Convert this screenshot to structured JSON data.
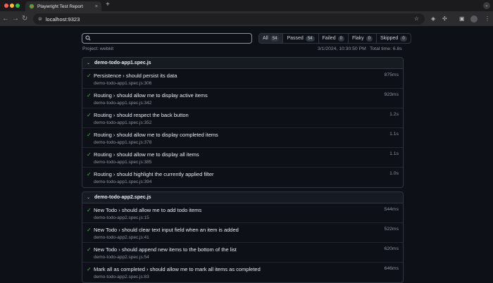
{
  "browser": {
    "tab_title": "Playwright Test Report",
    "tab_close": "×",
    "new_tab": "+",
    "url": "localhost:9323",
    "menu_glyph": "⌄"
  },
  "report": {
    "search": {
      "value": "",
      "placeholder": ""
    },
    "filters": [
      {
        "label": "All",
        "count": "54"
      },
      {
        "label": "Passed",
        "count": "54"
      },
      {
        "label": "Failed",
        "count": "0"
      },
      {
        "label": "Flaky",
        "count": "0"
      },
      {
        "label": "Skipped",
        "count": "0"
      }
    ],
    "project": "Project: webkit",
    "datetime": "3/1/2024, 10:30:50 PM",
    "total_time": "Total time: 6.8s",
    "groups": [
      {
        "file": "demo-todo-app1.spec.js",
        "tests": [
          {
            "title": "Persistence › should persist its data",
            "location": "demo-todo-app1.spec.js:306",
            "duration": "875ms"
          },
          {
            "title": "Routing › should allow me to display active items",
            "location": "demo-todo-app1.spec.js:342",
            "duration": "923ms"
          },
          {
            "title": "Routing › should respect the back button",
            "location": "demo-todo-app1.spec.js:352",
            "duration": "1.2s"
          },
          {
            "title": "Routing › should allow me to display completed items",
            "location": "demo-todo-app1.spec.js:378",
            "duration": "1.1s"
          },
          {
            "title": "Routing › should allow me to display all items",
            "location": "demo-todo-app1.spec.js:385",
            "duration": "1.1s"
          },
          {
            "title": "Routing › should highlight the currently applied filter",
            "location": "demo-todo-app1.spec.js:394",
            "duration": "1.0s"
          }
        ]
      },
      {
        "file": "demo-todo-app2.spec.js",
        "tests": [
          {
            "title": "New Todo › should allow me to add todo items",
            "location": "demo-todo-app2.spec.js:15",
            "duration": "544ms"
          },
          {
            "title": "New Todo › should clear text input field when an item is added",
            "location": "demo-todo-app2.spec.js:41",
            "duration": "522ms"
          },
          {
            "title": "New Todo › should append new items to the bottom of the list",
            "location": "demo-todo-app2.spec.js:54",
            "duration": "620ms"
          },
          {
            "title": "Mark all as completed › should allow me to mark all items as completed",
            "location": "demo-todo-app2.spec.js:83",
            "duration": "646ms"
          }
        ]
      }
    ]
  },
  "colors": {
    "pass": "#3fb950",
    "bg": "#0d1117",
    "border": "#30363d"
  }
}
